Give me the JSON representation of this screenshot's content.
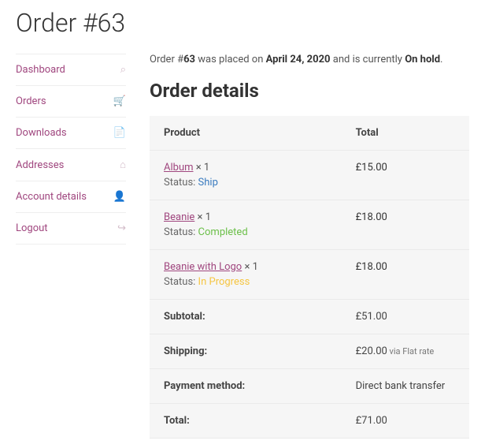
{
  "page_title": "Order #63",
  "order_meta": {
    "prefix": "Order #",
    "number": "63",
    "mid1": " was placed on ",
    "date": "April 24, 2020",
    "mid2": " and is currently ",
    "status": "On hold",
    "suffix": "."
  },
  "sidebar": {
    "items": [
      {
        "label": "Dashboard",
        "icon": "⌕"
      },
      {
        "label": "Orders",
        "icon": "🛒"
      },
      {
        "label": "Downloads",
        "icon": "📄"
      },
      {
        "label": "Addresses",
        "icon": "⌂"
      },
      {
        "label": "Account details",
        "icon": "👤"
      },
      {
        "label": "Logout",
        "icon": "↪"
      }
    ]
  },
  "details": {
    "heading": "Order details",
    "headers": {
      "product": "Product",
      "total": "Total"
    },
    "items": [
      {
        "name": "Album",
        "qty": "× 1",
        "status_label": "Status:",
        "status": "Ship",
        "status_class": "status-ship",
        "total": "£15.00"
      },
      {
        "name": "Beanie",
        "qty": "× 1",
        "status_label": "Status:",
        "status": "Completed",
        "status_class": "status-completed",
        "total": "£18.00"
      },
      {
        "name": "Beanie with Logo",
        "qty": "× 1",
        "status_label": "Status:",
        "status": "In Progress",
        "status_class": "status-progress",
        "total": "£18.00"
      }
    ],
    "footer": [
      {
        "label": "Subtotal:",
        "value": "£51.00",
        "extra": ""
      },
      {
        "label": "Shipping:",
        "value": "£20.00",
        "extra": " via Flat rate"
      },
      {
        "label": "Payment method:",
        "value": "Direct bank transfer",
        "extra": ""
      },
      {
        "label": "Total:",
        "value": "£71.00",
        "extra": ""
      }
    ]
  }
}
